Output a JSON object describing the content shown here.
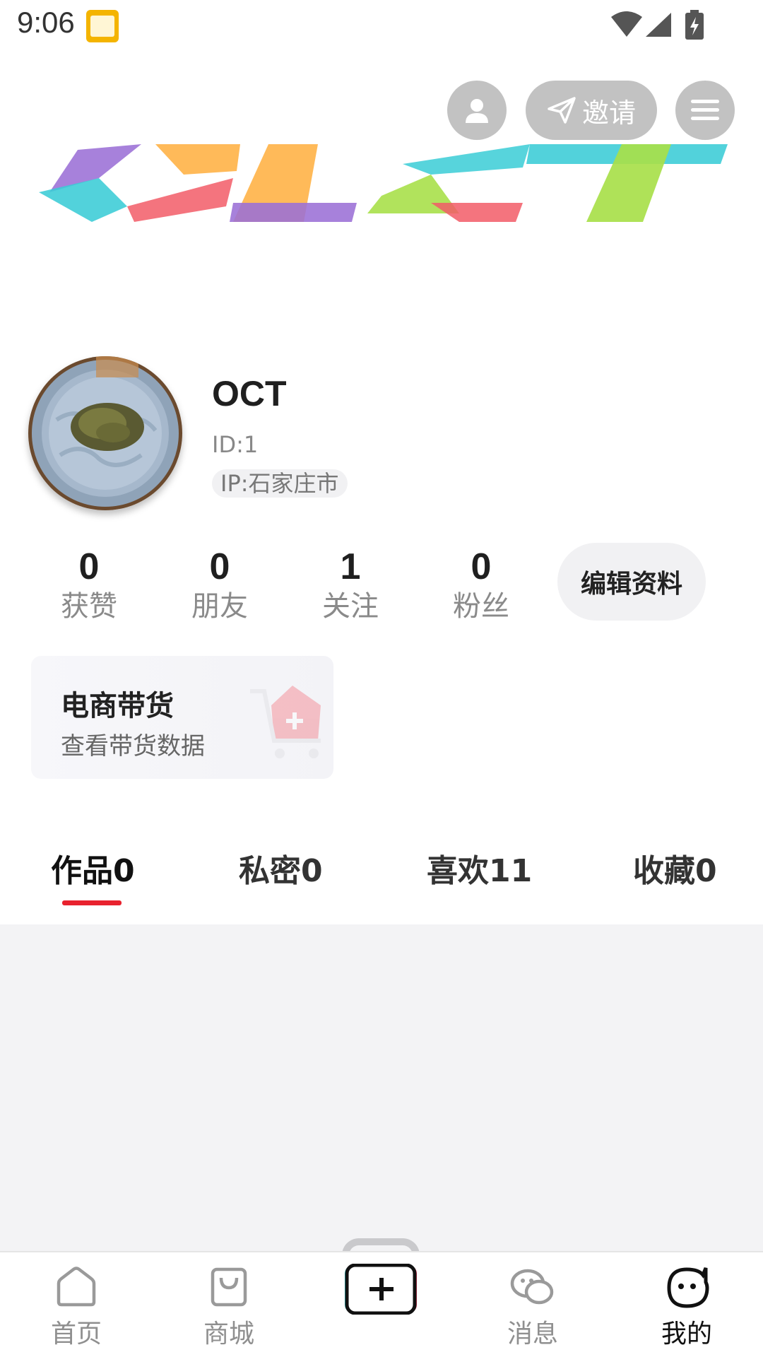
{
  "status_bar": {
    "time": "9:06"
  },
  "header": {
    "invite_label": "邀请",
    "icons": {
      "profile": "person-icon",
      "invite": "send-icon",
      "menu": "hamburger-menu-icon"
    },
    "banner_colors": [
      "#9B6FD6",
      "#FFB347",
      "#F25C67",
      "#3ACCD6",
      "#A8E04A"
    ]
  },
  "profile": {
    "name": "OCT",
    "id_text": "ID:1",
    "ip_text": "IP:石家庄市"
  },
  "stats": [
    {
      "value": "0",
      "label": "获赞"
    },
    {
      "value": "0",
      "label": "朋友"
    },
    {
      "value": "1",
      "label": "关注"
    },
    {
      "value": "0",
      "label": "粉丝"
    }
  ],
  "edit_button_label": "编辑资料",
  "ecommerce": {
    "title": "电商带货",
    "subtitle": "查看带货数据"
  },
  "tabs": [
    {
      "label": "作品0",
      "active": true
    },
    {
      "label": "私密0",
      "active": false
    },
    {
      "label": "喜欢11",
      "active": false
    },
    {
      "label": "收藏0",
      "active": false
    }
  ],
  "accent_color": "#E8222E",
  "bottom_nav": [
    {
      "label": "首页",
      "icon": "home-icon",
      "active": false
    },
    {
      "label": "商城",
      "icon": "shopping-bag-icon",
      "active": false
    },
    {
      "label": "",
      "icon": "add-icon",
      "active": false
    },
    {
      "label": "消息",
      "icon": "chat-icon",
      "active": false
    },
    {
      "label": "我的",
      "icon": "face-icon",
      "active": true
    }
  ]
}
